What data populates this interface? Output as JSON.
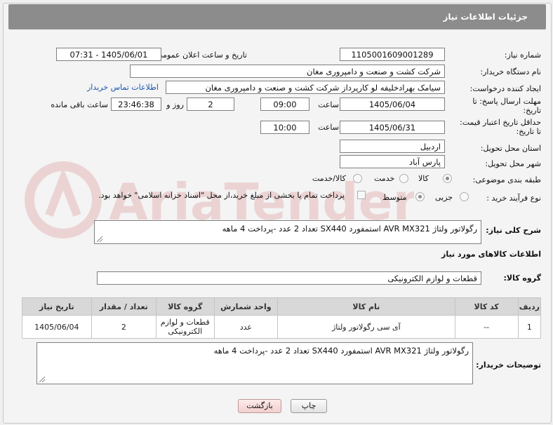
{
  "header": {
    "title": "جزئیات اطلاعات نیاز"
  },
  "fields": {
    "need_number_label": "شماره نیاز:",
    "need_number": "1105001609001289",
    "announce_label": "تاریخ و ساعت اعلان عمومی:",
    "announce_value": "1405/06/01 - 07:31",
    "buyer_org_label": "نام دستگاه خریدار:",
    "buyer_org": "شرکت کشت و صنعت و دامپروری مغان",
    "requester_label": "ایجاد کننده درخواست:",
    "requester": "سیامک بهرادخلیفه لو کارپرداز شرکت کشت و صنعت و دامپروری مغان",
    "contact_link": "اطلاعات تماس خریدار",
    "deadline_label_1": "مهلت ارسال پاسخ: تا",
    "deadline_label_2": "تاریخ:",
    "deadline_date": "1405/06/04",
    "time_label": "ساعت",
    "deadline_time": "09:00",
    "days_value": "2",
    "days_label": "روز و",
    "remaining_time": "23:46:38",
    "remaining_label": "ساعت باقی مانده",
    "price_valid_label_1": "حداقل تاریخ اعتبار قیمت:",
    "price_valid_label_2": "تا تاریخ:",
    "price_valid_date": "1405/06/31",
    "price_valid_time": "10:00",
    "province_label": "استان محل تحویل:",
    "province": "اردبیل",
    "city_label": "شهر محل تحویل:",
    "city": "پارس آباد",
    "category_label": "طبقه بندی موضوعی:",
    "category_options": [
      "کالا",
      "خدمت",
      "کالا/خدمت"
    ],
    "process_label": "نوع فرآیند خرید :",
    "process_options": [
      "جزیی",
      "متوسط"
    ],
    "payment_note": "پرداخت تمام یا بخشی از مبلغ خرید،از محل \"اسناد خزانه اسلامی\" خواهد بود.",
    "summary_label": "شرح کلی نیاز:",
    "summary": "رگولاتور ولتاژ  AVR MX321 استمفورد SX440  تعداد 2 عدد -پرداخت 4 ماهه",
    "goods_info_title": "اطلاعات کالاهای مورد نیاز",
    "goods_group_label": "گروه کالا:",
    "goods_group": "قطعات و لوازم الکترونیکی",
    "buyer_notes_label": "توضیحات خریدار:",
    "buyer_notes": "رگولاتور ولتاژ  AVR MX321 استمفورد SX440  تعداد 2 عدد -پرداخت 4 ماهه"
  },
  "table": {
    "headers": [
      "ردیف",
      "کد کالا",
      "نام کالا",
      "واحد شمارش",
      "گروه کالا",
      "تعداد / مقدار",
      "تاریخ نیاز"
    ],
    "rows": [
      [
        "1",
        "--",
        "آی سی رگولاتور ولتاژ",
        "عدد",
        "قطعات و لوازم الکترونیکی",
        "2",
        "1405/06/04"
      ]
    ]
  },
  "buttons": {
    "print": "چاپ",
    "back": "بازگشت"
  },
  "watermark": {
    "text": "AriaTender.net"
  }
}
